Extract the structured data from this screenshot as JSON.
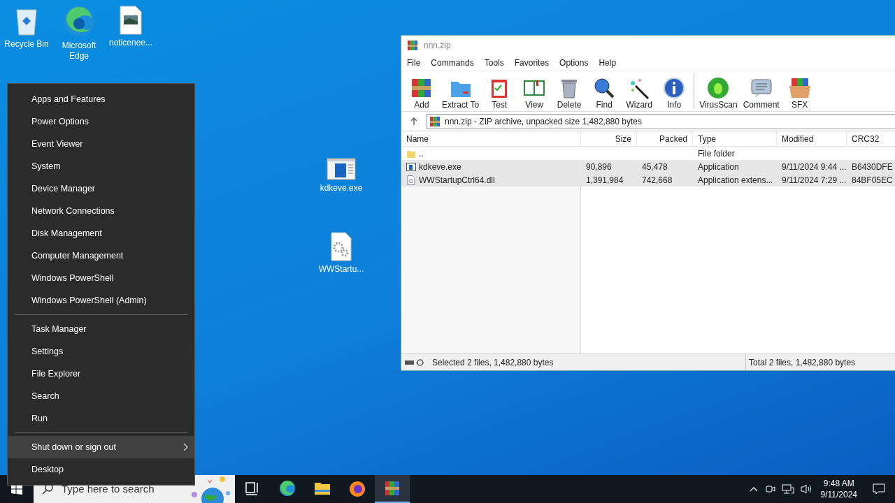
{
  "desktop_icons": [
    {
      "label": "Recycle Bin",
      "kind": "recycle"
    },
    {
      "label": "Microsoft Edge",
      "kind": "edge"
    },
    {
      "label": "noticenee...",
      "kind": "image"
    },
    {
      "label": "kdkeve.exe",
      "kind": "app"
    },
    {
      "label": "WWStartu...",
      "kind": "gear"
    }
  ],
  "context_menu": {
    "groups": [
      [
        {
          "label": "Apps and Features",
          "selected": false,
          "has_submenu": false
        },
        {
          "label": "Power Options",
          "selected": false,
          "has_submenu": false
        },
        {
          "label": "Event Viewer",
          "selected": false,
          "has_submenu": false
        },
        {
          "label": "System",
          "selected": false,
          "has_submenu": false
        },
        {
          "label": "Device Manager",
          "selected": false,
          "has_submenu": false
        },
        {
          "label": "Network Connections",
          "selected": false,
          "has_submenu": false
        },
        {
          "label": "Disk Management",
          "selected": false,
          "has_submenu": false
        },
        {
          "label": "Computer Management",
          "selected": false,
          "has_submenu": false
        },
        {
          "label": "Windows PowerShell",
          "selected": false,
          "has_submenu": false
        },
        {
          "label": "Windows PowerShell (Admin)",
          "selected": false,
          "has_submenu": false
        }
      ],
      [
        {
          "label": "Task Manager",
          "selected": false,
          "has_submenu": false
        },
        {
          "label": "Settings",
          "selected": false,
          "has_submenu": false
        },
        {
          "label": "File Explorer",
          "selected": false,
          "has_submenu": false
        },
        {
          "label": "Search",
          "selected": false,
          "has_submenu": false
        },
        {
          "label": "Run",
          "selected": false,
          "has_submenu": false
        }
      ],
      [
        {
          "label": "Shut down or sign out",
          "selected": true,
          "has_submenu": true
        },
        {
          "label": "Desktop",
          "selected": false,
          "has_submenu": false
        }
      ]
    ]
  },
  "window": {
    "title": "nnn.zip",
    "menu": [
      "File",
      "Commands",
      "Tools",
      "Favorites",
      "Options",
      "Help"
    ],
    "toolbar": [
      {
        "label": "Add",
        "kind": "add"
      },
      {
        "label": "Extract To",
        "kind": "extract"
      },
      {
        "label": "Test",
        "kind": "test"
      },
      {
        "label": "View",
        "kind": "view"
      },
      {
        "label": "Delete",
        "kind": "delete"
      },
      {
        "label": "Find",
        "kind": "find"
      },
      {
        "label": "Wizard",
        "kind": "wizard"
      },
      {
        "label": "Info",
        "kind": "info"
      },
      {
        "label": "VirusScan",
        "kind": "virus"
      },
      {
        "label": "Comment",
        "kind": "comment"
      },
      {
        "label": "SFX",
        "kind": "sfx"
      }
    ],
    "path": "nnn.zip - ZIP archive, unpacked size 1,482,880 bytes",
    "table": {
      "columns": [
        "Name",
        "Size",
        "Packed",
        "Type",
        "Modified",
        "CRC32"
      ],
      "rows": [
        {
          "kind": "folder",
          "selected": false,
          "cells": [
            "..",
            "",
            "",
            "File folder",
            "",
            ""
          ]
        },
        {
          "kind": "exe",
          "selected": true,
          "cells": [
            "kdkeve.exe",
            "90,896",
            "45,478",
            "Application",
            "9/11/2024 9:44 ...",
            "B6430DFE"
          ]
        },
        {
          "kind": "dll",
          "selected": true,
          "cells": [
            "WWStartupCtrl64.dll",
            "1,391,984",
            "742,668",
            "Application extens...",
            "9/11/2024 7:29 ...",
            "84BF05EC"
          ]
        }
      ]
    },
    "status_left": "Selected 2 files, 1,482,880 bytes",
    "status_right": "Total 2 files, 1,482,880 bytes"
  },
  "taskbar": {
    "search": {
      "placeholder": "Type here to search"
    },
    "apps": [
      {
        "kind": "taskview",
        "active": false
      },
      {
        "kind": "edge",
        "active": false
      },
      {
        "kind": "explorer",
        "active": false
      },
      {
        "kind": "firefox",
        "active": false
      },
      {
        "kind": "winrar",
        "active": true
      }
    ],
    "time": "9:48 AM",
    "date": "9/11/2024"
  }
}
